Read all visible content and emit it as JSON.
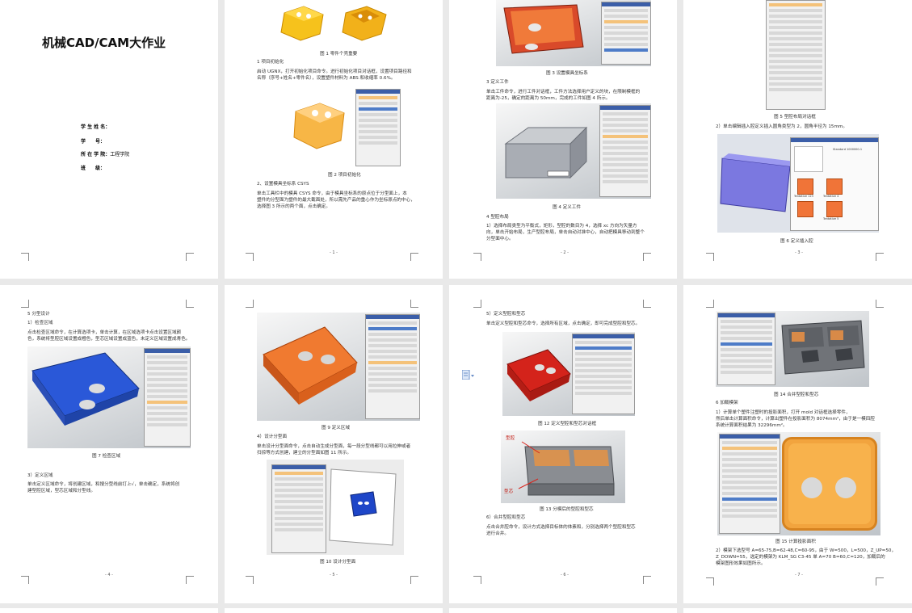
{
  "colors": {
    "accent_orange": "#f08a3c",
    "part_yellow": "#f3b51b",
    "mold_blue": "#2f5fd6",
    "mold_red": "#c9291f",
    "dialog_blue": "#3b5ea8"
  },
  "pages": {
    "p1": {
      "title": "机械CAD/CAM大作业",
      "fields": [
        {
          "label": "学 生 姓 名：",
          "value": ""
        },
        {
          "label": "学　　号：",
          "value": ""
        },
        {
          "label": "所 在 学 院：",
          "value": "工程学院"
        },
        {
          "label": "班　　级：",
          "value": ""
        }
      ]
    },
    "p2": {
      "cap1": "图 1 零件个壳重要",
      "h1": "1  项目初始化",
      "p1": "启动 UGNX，打开初始化项目命令。进行初始化项目对话框，设置项目路径和",
      "p1b": "名称（序号+姓名+零件名），设置塑件材料为 ABS 和收缩率 0.6%。",
      "cap2": "图 2 项目初始化",
      "h2": "2、设置模具坐标系 CSYS",
      "p2": "单击工具栏中的模具 CSYS 命令，由于模具坐标系的原点位于分型面上，本",
      "p2b": "塑件的分型面为塑件的最大截面处，所以需先产品的重心作为坐标原点的中心，",
      "p2c": "选择图 3 所示的两个面，点击确定。",
      "pnum": "- 1 -"
    },
    "p3": {
      "cap3": "图 3 设置模具坐标系",
      "h3": "3 定义工件",
      "p3": "单击工件命令，进行工件对话框，工件方法选择用户定义的块，在限制模框的",
      "p3b": "距离为-25，确定的距离为 50mm，完成的工件如图 4 所示。",
      "cap4": "图 4 定义工件",
      "h4": "4 型腔布局",
      "p4": "1）选择布局类型为平衡式，矩形，型腔的数目为 4，选择 xc 方向为矢量方",
      "p4b": "向，单击开始布局，生产型腔布局，单击自动对准中心，自动把模具移动到整个",
      "p4c": "分型面中心。",
      "pnum": "- 2 -"
    },
    "p4": {
      "cap5": "图 5 型腔布局对话框",
      "p5": "2）单击编辑插入腔定义插入圆角类型为 2，圆角半径为 15mm。",
      "cap6": "图 6 定义插入腔",
      "pnum": "- 3 -",
      "labels": [
        "Standard 1000000-1",
        "Tentative 123",
        "Tentative 4",
        "Tentative 5"
      ]
    },
    "p5": {
      "h": "5 分型设计",
      "h1": "1）检查区域",
      "p1": "点击检查区域命令，在计算选项卡，单击计算，在区域选项卡点击设置区域颜",
      "p1b": "色，系统将型腔区域设置成橙色，型芯区域设置成蓝色，未定义区域设置成青色。",
      "cap7": "图 7 检查区域",
      "h3": "3）定义区域",
      "p3": "单击定义区域命令，将创建区域，和搜分型线前打上√，单击确定，系统将创",
      "p3b": "建型腔区域，型芯区域和分型线。",
      "pnum": "- 4 -"
    },
    "p6": {
      "cap9": "图 9 定义区域",
      "h4": "4）设计分型面",
      "p4": "单击设计分型面命令，点击自动生成分型面，每一段分型线都可以用拉伸或者",
      "p4b": "扫掠等方式创建，建立的分型面如图 11 所示。",
      "cap10": "图 10 设计分型面",
      "pnum": "- 5 -"
    },
    "p7": {
      "h5": "5）定义型腔和型芯",
      "p5": "单击定义型腔和型芯命令，选择所有区域，点击确定，即可完成型腔和型芯。",
      "cap12": "图 12 定义型腔和型芯对话框",
      "lbl_a": "型腔",
      "lbl_b": "型芯",
      "cap13": "图 13 分模后的型腔和型芯",
      "h6": "6）合并型腔和型芯",
      "p6": "点击合并腔命令，设计方式选择目标体的体素和，分别选择两个型腔和型芯",
      "p6b": "进行合并。",
      "pnum": "- 6 -"
    },
    "p8": {
      "cap14": "图 14 合并型腔和型芯",
      "h6": "6 加载模架",
      "p6": "1）计算单个塑件注塑时的投影面积，打开 mold 对话框选择零件，",
      "p6b": "然后单击计算面积命令，计算出塑件在投影面积为 8074mm²，由于是一模四腔",
      "p6c": "系统计算面积结果为 32296mm²。",
      "cap15": "图 15 计算投影面积",
      "p7": "2）模架下选型号 A=65-75,B=62-48,C=60-95，由于 W=500，L=500，Z_UP=50，",
      "p7b": "Z_DOWN=55，选定的模架为 KLM_SG C3-45 单 A=70 B=60,C=120，加载后的",
      "p7c": "模架图形效果如图所示。",
      "pnum": "- 7 -"
    }
  }
}
